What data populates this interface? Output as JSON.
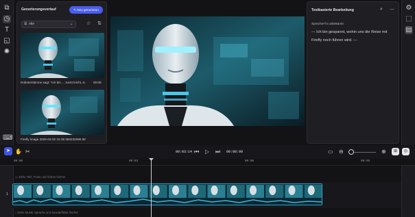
{
  "history": {
    "title": "Generierungsverlauf",
    "new_button": "Neu generieren",
    "filter_value": "Alle",
    "items": [
      {
        "caption": "Roboterstimme sagt: \"Ich bin ... zuckt leicht, schwenkt",
        "duration": "00:08"
      },
      {
        "caption": "Firefly image 2026-04-02 10-25 550232595 8K"
      }
    ]
  },
  "text_panel": {
    "title": "Textbasierte Bearbeitung",
    "speaker": "Sprecher*in unbekannt",
    "transcript": "--- Ich bin gespannt, wohin uns die Reise mit Firefly noch führen wird. ---"
  },
  "toolbar": {
    "current_time": "00:03:14",
    "total_time": "00:08:00"
  },
  "ruler": {
    "ticks": [
      "00:00",
      "00:03",
      "00:06",
      "00:09"
    ]
  },
  "tracks": {
    "top_hint": "Ziehe Titel, Fotos und Videos hierher",
    "bottom_hint": "Ziehe Musik, Sprache und Soundeffekte hierher",
    "track_number": "1"
  },
  "colors": {
    "accent": "#4a5df0",
    "clip_border": "#2fa4c8",
    "background": "#131316"
  }
}
